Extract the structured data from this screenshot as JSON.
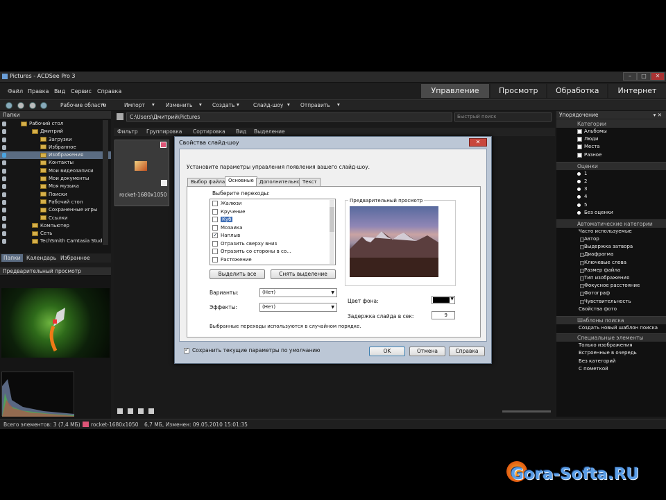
{
  "window": {
    "title": "Pictures - ACDSee Pro 3",
    "buttons": [
      "–",
      "□",
      "✕"
    ]
  },
  "menu": [
    "Файл",
    "Правка",
    "Вид",
    "Сервис",
    "Справка"
  ],
  "modes": [
    "Управление",
    "Просмотр",
    "Обработка",
    "Интернет"
  ],
  "toolbar": [
    "Рабочие области",
    "Импорт",
    "Изменить",
    "Создать",
    "Слайд-шоу",
    "Отправить"
  ],
  "folders_panel": {
    "title": "Папки",
    "items": [
      "Рабочий стол",
      "Дмитрий",
      "Загрузки",
      "Избранное",
      "Изображения",
      "Контакты",
      "Мои видеозаписи",
      "Мои документы",
      "Моя музыка",
      "Поиски",
      "Рабочий стол",
      "Сохраненные игры",
      "Ссылки",
      "Компьютер",
      "Сеть",
      "TechSmith Camtasia Studio"
    ],
    "tabs": [
      "Папки",
      "Календарь",
      "Избранное"
    ]
  },
  "preview_panel": {
    "title": "Предварительный просмотр"
  },
  "path": {
    "value": "C:\\Users\\Дмитрий\\Pictures",
    "search_placeholder": "Быстрый поиск"
  },
  "filterbar": [
    "Фильтр",
    "Группировка",
    "Сортировка",
    "Вид",
    "Выделение"
  ],
  "thumbnail": {
    "label": "rocket-1680x1050"
  },
  "dialog": {
    "title": "Свойства слайд-шоу",
    "close": "✕",
    "intro": "Установите параметры управления появления вашего слайд-шоу.",
    "tabs": [
      "Выбор файла",
      "Основные",
      "Дополнительно",
      "Текст"
    ],
    "choose_label": "Выберите переходы:",
    "transitions": [
      {
        "label": "Жалюзи",
        "checked": false
      },
      {
        "label": "Кручение",
        "checked": false
      },
      {
        "label": "Куб",
        "checked": false
      },
      {
        "label": "Мозаика",
        "checked": false
      },
      {
        "label": "Наплыв",
        "checked": true
      },
      {
        "label": "Отразить сверху вниз",
        "checked": false
      },
      {
        "label": "Отразить со стороны в со...",
        "checked": false
      },
      {
        "label": "Растяжение",
        "checked": false
      }
    ],
    "select_all": "Выделить все",
    "deselect": "Снять выделение",
    "variants_label": "Варианты:",
    "variants_value": "(Нет)",
    "effects_label": "Эффекты:",
    "effects_value": "(Нет)",
    "note": "Выбранные переходы используются в случайном порядке.",
    "preview_label": "Предварительный просмотр",
    "bg_label": "Цвет фона:",
    "delay_label": "Задержка слайда в сек:",
    "delay_value": "9",
    "save_default": "Сохранить текущие параметры по умолчанию",
    "ok": "OK",
    "cancel": "Отмена",
    "help": "Справка"
  },
  "organize": {
    "title": "Упорядочение",
    "categories_title": "Категории",
    "categories": [
      "Альбомы",
      "Люди",
      "Места",
      "Разное"
    ],
    "ratings_title": "Оценки",
    "ratings": [
      "1",
      "2",
      "3",
      "4",
      "5",
      "Без оценки"
    ],
    "auto_title": "Автоматические категории",
    "auto_head": "Часто используемые",
    "auto": [
      "Автор",
      "Выдержка затвора",
      "Диафрагма",
      "Ключевые слова",
      "Размер файла",
      "Тип изображения",
      "Фокусное расстояние",
      "Фотограф",
      "Чувствительность"
    ],
    "photo_props": "Свойства фото",
    "saved_title": "Шаблоны поиска",
    "saved_link": "Создать новый шаблон поиска",
    "special_title": "Специальные элементы",
    "special": [
      "Только изображения",
      "Встроенные в очередь",
      "Без категорий",
      "С пометкой"
    ]
  },
  "status": {
    "count": "Всего элементов: 3 (7,4 МБ)",
    "file": "rocket-1680x1050",
    "info": "6,7 МБ, Изменен: 09.05.2010 15:01:35"
  },
  "watermark": "Gora-Softa.RU"
}
